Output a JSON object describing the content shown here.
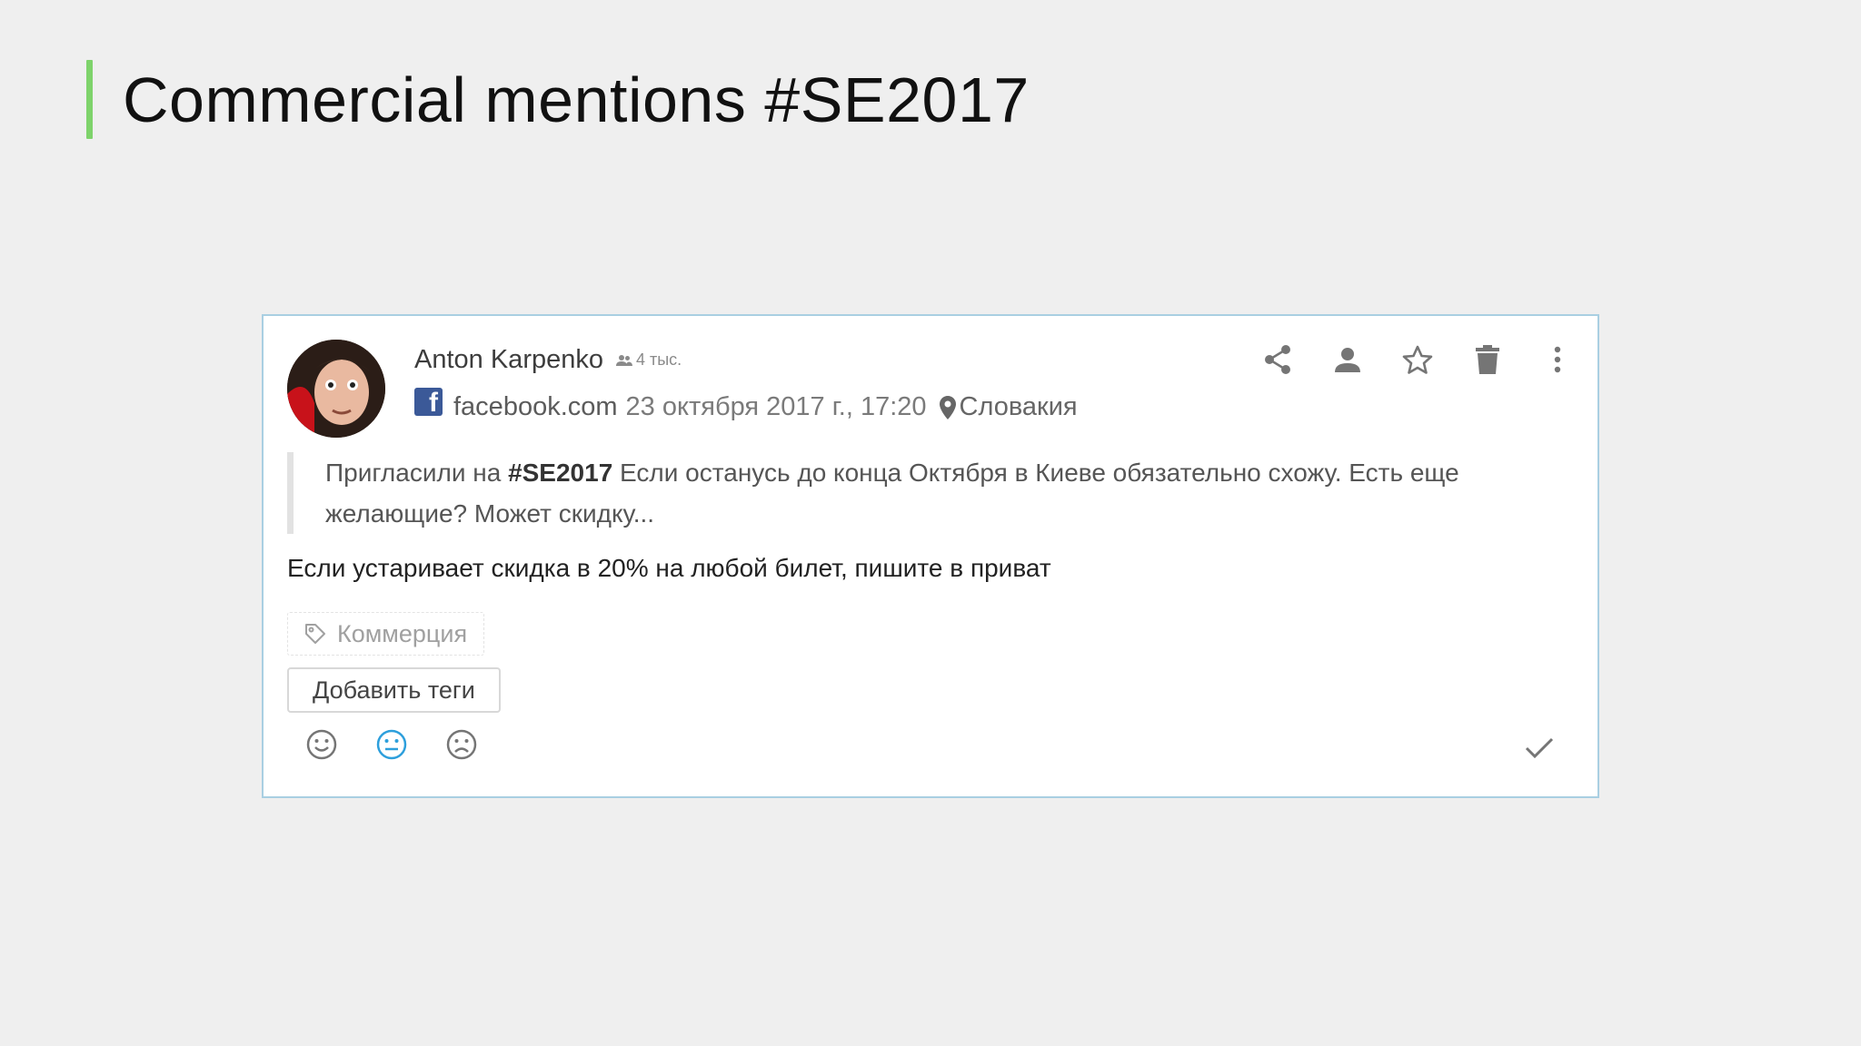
{
  "slide": {
    "title": "Commercial mentions #SE2017"
  },
  "mention": {
    "author": "Anton Karpenko",
    "followers": "4 тыс.",
    "source": "facebook.com",
    "date": "23 октября 2017 г., 17:20",
    "location": "Словакия",
    "quote": {
      "before": "Пригласили на ",
      "hashtag": "#SE2017",
      "after": " Если останусь до конца Октября в Киеве обязательно схожу. Есть еще желающие? Может скидку..."
    },
    "reply": "Если устаривает скидка в 20% на любой билет, пишите в приват",
    "tag": "Коммерция",
    "add_tags_label": "Добавить теги"
  },
  "actions": [
    "share-icon",
    "user-icon",
    "star-icon",
    "trash-icon",
    "more-vertical-icon"
  ],
  "sentiment": {
    "options": [
      "positive-face-icon",
      "neutral-face-icon",
      "negative-face-icon"
    ],
    "selected": "neutral",
    "selected_color": "#2d9fdc"
  },
  "colors": {
    "accent_bar": "#7ed36b",
    "card_border": "#a9cfe2",
    "facebook": "#3b5998"
  }
}
